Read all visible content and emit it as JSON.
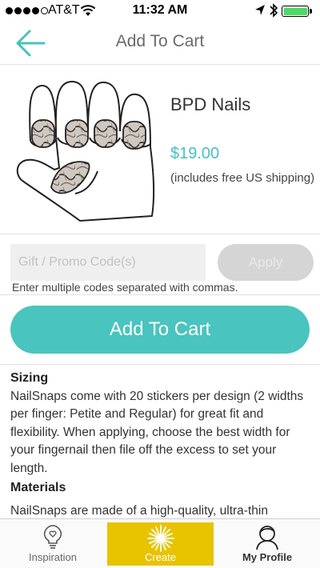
{
  "status_bar": {
    "carrier": "AT&T",
    "time": "11:32 AM"
  },
  "header": {
    "title": "Add To Cart",
    "back_icon": "back-arrow-icon"
  },
  "product": {
    "name": "BPD Nails",
    "price": "$19.00",
    "shipping_note": "(includes free US shipping)"
  },
  "promo": {
    "placeholder": "Gift / Promo Code(s)",
    "value": "",
    "apply_label": "Apply",
    "hint": "Enter multiple codes separated with commas."
  },
  "cart": {
    "add_label": "Add To Cart"
  },
  "details": {
    "sizing_heading": "Sizing",
    "sizing_text": "NailSnaps come with 20 stickers per design (2 widths per finger: Petite and Regular) for great fit and flexibility. When applying, choose the best width for your fingernail then file off the excess to set your length.",
    "materials_heading": "Materials",
    "materials_text": "NailSnaps are made of a high-quality, ultra-thin"
  },
  "tabs": [
    {
      "label": "Inspiration",
      "icon": "lightbulb-heart-icon"
    },
    {
      "label": "Create",
      "icon": "sparkle-icon"
    },
    {
      "label": "My Profile",
      "icon": "profile-icon"
    }
  ],
  "colors": {
    "accent": "#4ac4be",
    "create_tab": "#e8c300",
    "battery": "#4cd964"
  }
}
